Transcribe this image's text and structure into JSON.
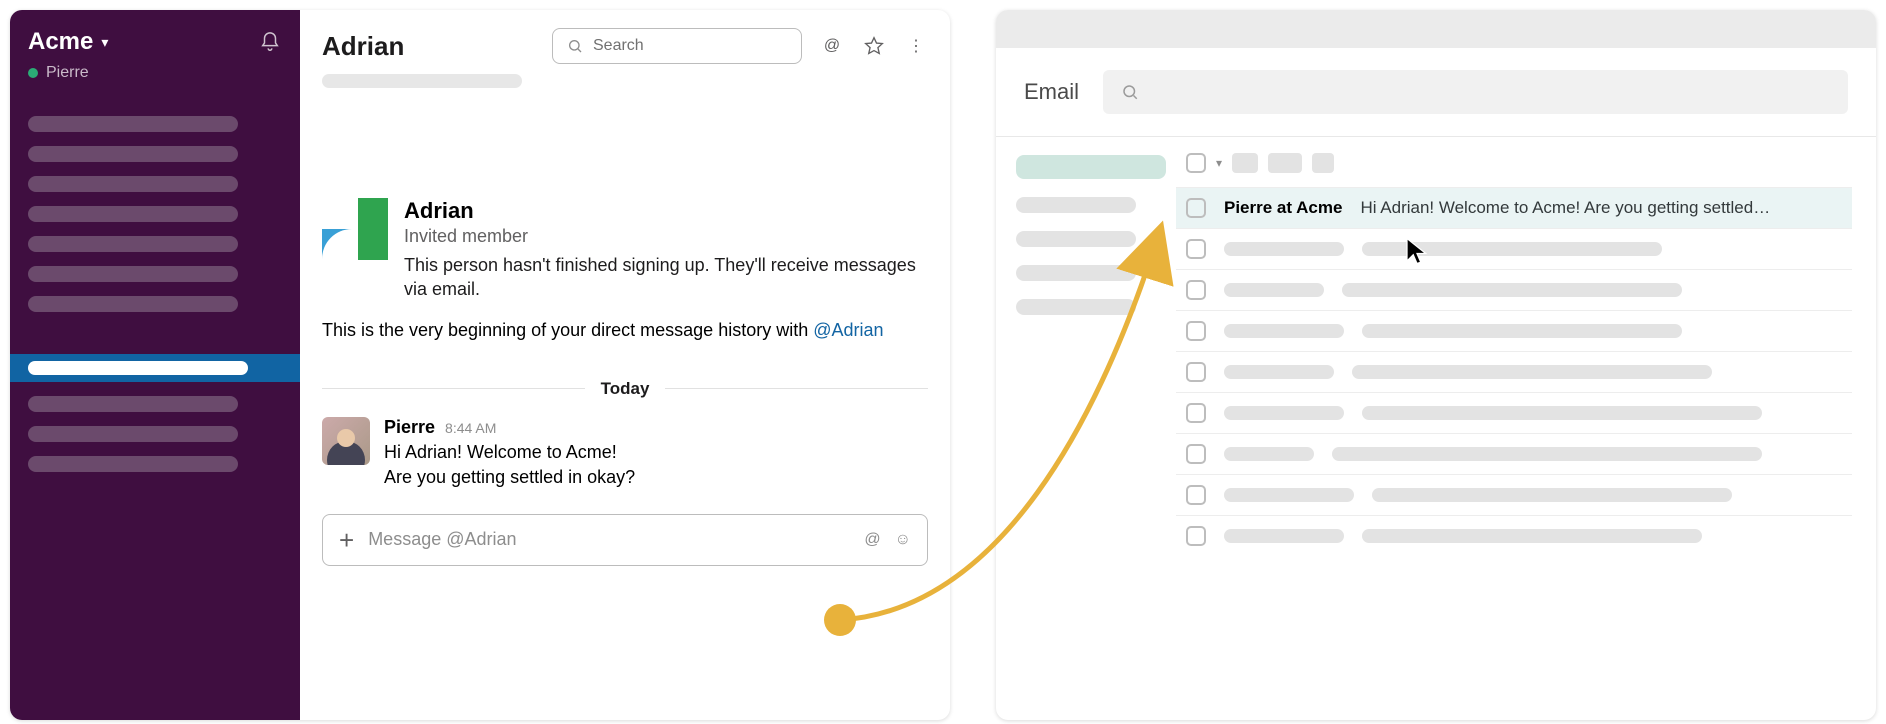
{
  "slack": {
    "workspace": "Acme",
    "current_user": "Pierre",
    "dm_title": "Adrian",
    "search_placeholder": "Search",
    "intro": {
      "name": "Adrian",
      "role": "Invited member",
      "desc": "This person hasn't finished signing up. They'll receive messages via email."
    },
    "beginning_prefix": "This is the very beginning of your direct message history with ",
    "beginning_mention": "@Adrian",
    "divider_label": "Today",
    "message": {
      "author": "Pierre",
      "time": "8:44 AM",
      "line1": "Hi Adrian! Welcome to Acme!",
      "line2": "Are you getting settled in okay?"
    },
    "composer_placeholder": "Message @Adrian"
  },
  "email": {
    "app_title": "Email",
    "highlight": {
      "sender": "Pierre at Acme",
      "subject": "Hi Adrian! Welcome to Acme! Are you getting settled…"
    }
  },
  "icons": {
    "bell": "bell-icon",
    "chevron_down": "chevron-down-icon",
    "search": "search-icon",
    "at": "at-icon",
    "star": "star-icon",
    "more": "more-vertical-icon",
    "plus": "plus-icon",
    "emoji": "emoji-icon"
  },
  "colors": {
    "slack_sidebar": "#3f0e40",
    "selected_channel": "#1164a3",
    "presence": "#2bac76",
    "link": "#1264a3",
    "arrow": "#e8b23b"
  }
}
